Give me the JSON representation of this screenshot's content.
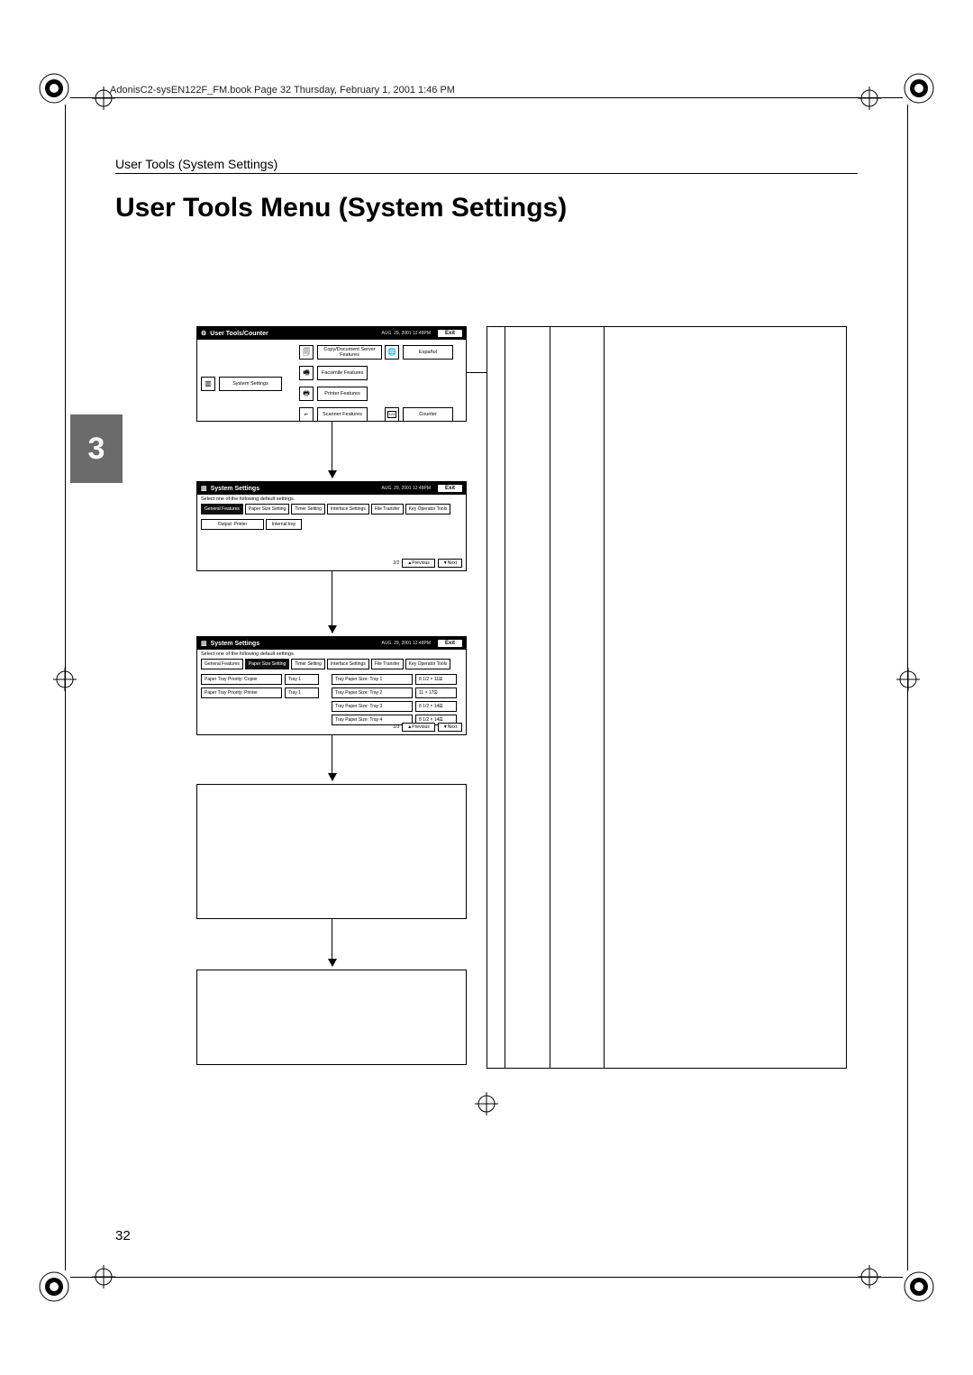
{
  "book_header": "AdonisC2-sysEN122F_FM.book  Page 32  Thursday, February 1, 2001  1:46 PM",
  "running_head": "User Tools (System Settings)",
  "title": "User Tools Menu (System Settings)",
  "chapter_tab": "3",
  "page_number": "32",
  "shot1": {
    "title": "User Tools/Counter",
    "clock": "AUG. 29, 2001  12:48PM",
    "exit": "Exit",
    "left_button": "System Settings",
    "center": [
      "Copy/Document Server Features",
      "Facsimile Features",
      "Printer Features",
      "Scanner Features"
    ],
    "right": [
      "Español",
      "Counter"
    ]
  },
  "shot2": {
    "title": "System Settings",
    "clock": "AUG. 29, 2001  12:48PM",
    "exit": "Exit",
    "caption": "Select one of the following default settings.",
    "tabs": [
      "General Features",
      "Paper Size Setting",
      "Timer Setting",
      "Interface Settings",
      "File Transfer",
      "Key Operator Tools"
    ],
    "tabs2": [
      "Output: Printer",
      "Internal tray"
    ],
    "page": "2/2",
    "prev": "▲Previous",
    "next": "▼Next"
  },
  "shot3": {
    "title": "System Settings",
    "clock": "AUG. 29, 2001  12:48PM",
    "exit": "Exit",
    "caption": "Select one of the following default settings.",
    "tabs": [
      "General Features",
      "Paper Size Setting",
      "Timer Setting",
      "Interface Settings",
      "File Transfer",
      "Key Operator Tools"
    ],
    "rowsL": [
      {
        "label": "Paper Tray Priority: Copier",
        "val": "Tray 1"
      },
      {
        "label": "Paper Tray Priority: Printer",
        "val": "Tray 1"
      }
    ],
    "rowsR": [
      {
        "label": "Tray Paper Size: Tray 1",
        "val": "8 1/2 × 11⮽"
      },
      {
        "label": "Tray Paper Size: Tray 2",
        "val": "11 × 17⮽"
      },
      {
        "label": "Tray Paper Size: Tray 3",
        "val": "8 1/2 × 14⮽"
      },
      {
        "label": "Tray Paper Size: Tray 4",
        "val": "8 1/2 × 14⮽"
      }
    ],
    "page": "1/3",
    "prev": "▲Previous",
    "next": "▼Next"
  }
}
